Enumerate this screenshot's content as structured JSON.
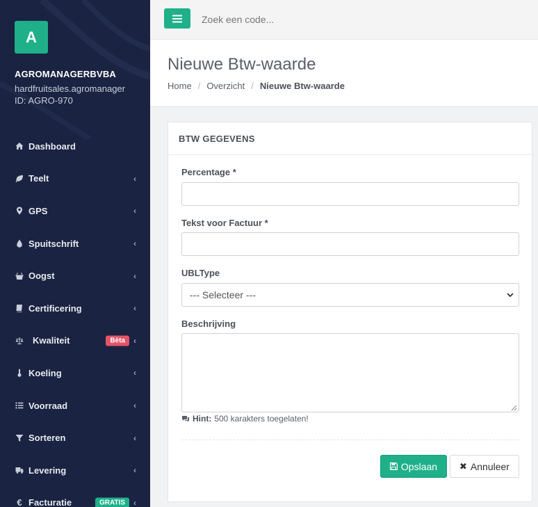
{
  "sidebar": {
    "brand_letter": "A",
    "company_name": "AGROMANAGERBVBA",
    "company_domain": "hardfruitsales.agromanager",
    "company_id": "ID: AGRO-970",
    "items": [
      {
        "label": "Dashboard",
        "icon": "home-icon"
      },
      {
        "label": "Teelt",
        "icon": "leaf-icon"
      },
      {
        "label": "GPS",
        "icon": "map-marker-icon"
      },
      {
        "label": "Spuitschrift",
        "icon": "tint-icon"
      },
      {
        "label": "Oogst",
        "icon": "basket-icon"
      },
      {
        "label": "Certificering",
        "icon": "book-icon"
      },
      {
        "label": "Kwaliteit",
        "icon": "balance-scale-icon",
        "badge": "Bèta"
      },
      {
        "label": "Koeling",
        "icon": "thermometer-icon"
      },
      {
        "label": "Voorraad",
        "icon": "list-icon"
      },
      {
        "label": "Sorteren",
        "icon": "filter-icon"
      },
      {
        "label": "Levering",
        "icon": "truck-icon"
      },
      {
        "label": "Facturatie",
        "icon": "euro-icon",
        "badge": "GRATIS"
      }
    ]
  },
  "topbar": {
    "search_placeholder": "Zoek een code..."
  },
  "header": {
    "title": "Nieuwe Btw-waarde",
    "breadcrumb": [
      "Home",
      "Overzicht",
      "Nieuwe Btw-waarde"
    ]
  },
  "form": {
    "card_title": "BTW GEGEVENS",
    "percentage_label": "Percentage *",
    "percentage_value": "",
    "tekst_label": "Tekst voor Factuur *",
    "tekst_value": "",
    "ubltype_label": "UBLType",
    "ubltype_selected": "--- Selecteer ---",
    "beschrijving_label": "Beschrijving",
    "hint_label": "Hint:",
    "hint_text": "500 karakters toegelaten!",
    "save_label": "Opslaan",
    "cancel_label": "Annuleer"
  },
  "colors": {
    "sidebar_bg": "#1a2341",
    "accent": "#1fb08a",
    "beta_badge": "#e45467"
  }
}
